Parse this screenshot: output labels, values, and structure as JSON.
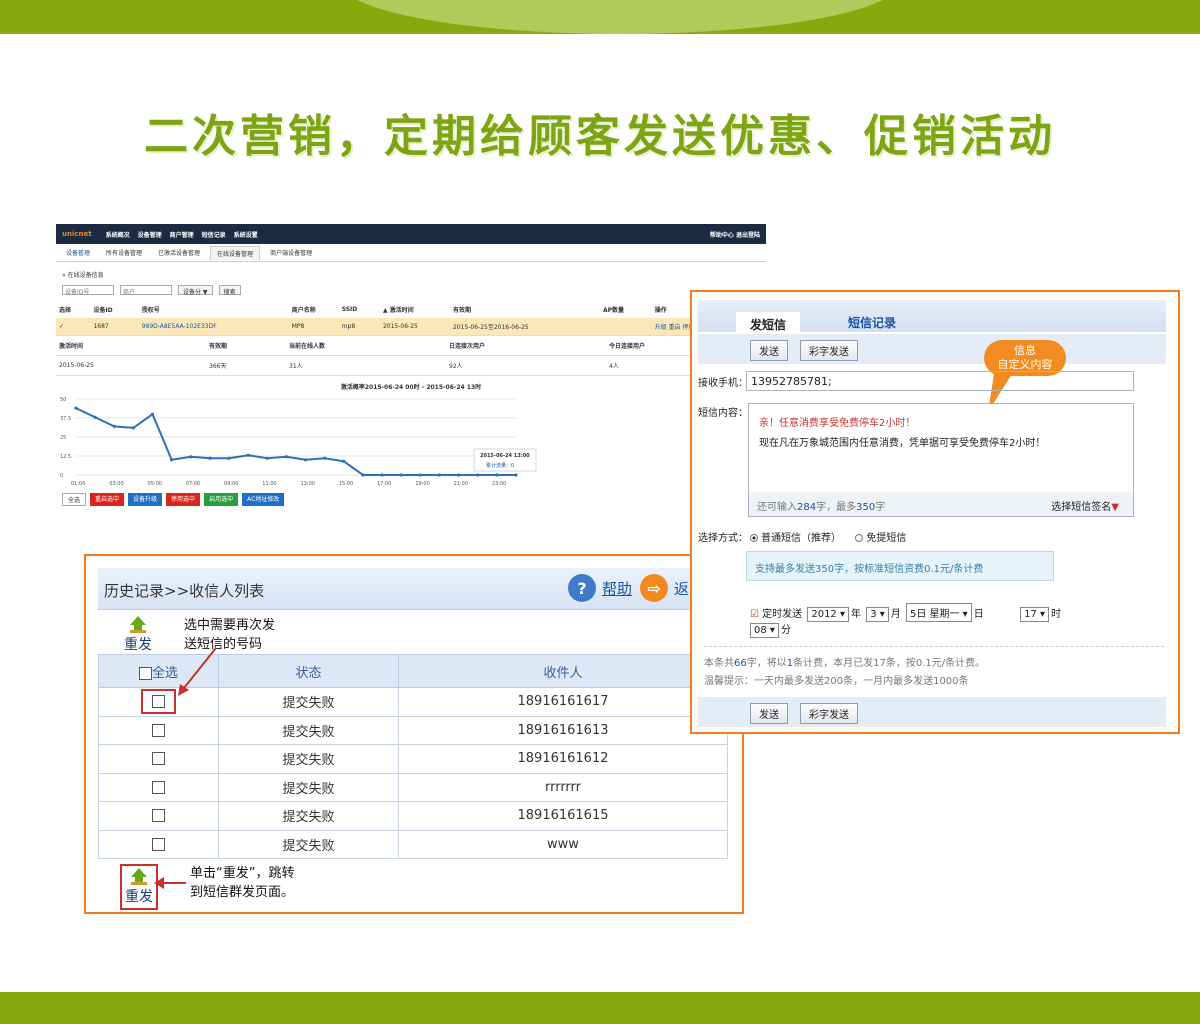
{
  "headline": "二次营销，定期给顾客发送优惠、促销活动",
  "dashboard": {
    "logo": "unicnet",
    "nav_items": [
      "系统概况",
      "设备管理",
      "商户管理",
      "短信记录",
      "系统设置"
    ],
    "nav_right": "帮助中心  退出登陆",
    "sub_tabs": [
      "设备管理",
      "所有设备管理",
      "已激活设备管理",
      "在线设备管理",
      "商户端设备管理"
    ],
    "breadcrumb": "» 在线设备信息",
    "filter_device": "设备ID号",
    "filter_shop": "商户",
    "filter_select": "设备分 ▼",
    "filter_search": "搜索",
    "columns": [
      "选择",
      "设备ID",
      "授权号",
      "商户名称",
      "SSID",
      "▲ 激活时间",
      "有效期",
      "AP数量",
      "操作"
    ],
    "row": {
      "id": "1687",
      "code": "989D-A8E5AA-102E33DF",
      "shop": "MP8",
      "ssid": "mp8",
      "activated": "2015-06-25",
      "valid": "2015-06-25至2016-06-25",
      "ops": "升级 重启 停用 远程"
    },
    "summary_headers": [
      "激活时间",
      "有效期",
      "当前在线人数",
      "日连接次用户",
      "今日连接用户"
    ],
    "summary_values": [
      "2015-06-25",
      "366天",
      "31人",
      "92人",
      "4人"
    ],
    "chart_title": "激活概率2015-06-24 00时 - 2015-06-24 13时",
    "tooltip_title": "2015-06-24 13:00",
    "tooltip_value": "累计流量：0",
    "buttons": [
      "全选",
      "重启选中",
      "设备升级",
      "停用选中",
      "启用选中",
      "AC地址修改"
    ],
    "button_colors": [
      "#ffffff",
      "#d9261c",
      "#1c70c8",
      "#d9261c",
      "#25a03a",
      "#1c70c8"
    ]
  },
  "chart_data": {
    "type": "line",
    "title": "激活概率2015-06-24 00时 - 2015-06-24 13时",
    "categories": [
      "01:00",
      "02:00",
      "03:00",
      "04:00",
      "05:00",
      "06:00",
      "07:00",
      "08:00",
      "09:00",
      "10:00",
      "11:00",
      "12:00",
      "13:00",
      "14:00",
      "15:00",
      "16:00",
      "17:00",
      "18:00",
      "19:00",
      "20:00",
      "21:00",
      "22:00",
      "23:00",
      "24:00"
    ],
    "x_tick_labels": [
      "01:00",
      "03:00",
      "05:00",
      "07:00",
      "09:00",
      "11:00",
      "13:00",
      "15:00",
      "17:00",
      "19:00",
      "21:00",
      "23:00"
    ],
    "values": [
      44,
      38,
      32,
      31,
      40,
      10,
      12,
      11,
      11,
      13,
      11,
      12,
      10,
      11,
      9,
      0,
      0,
      0,
      0,
      0,
      0,
      0,
      0,
      0
    ],
    "y_tick_labels": [
      "0",
      "12.5",
      "25",
      "37.5",
      "50"
    ],
    "ylim": [
      0,
      50
    ],
    "color": "#2f6fba"
  },
  "history": {
    "title": "历史记录>>收信人列表",
    "help": "帮助",
    "back_cut": "返",
    "reissue_label": "重发",
    "note_top": [
      "选中需要再次发",
      "送短信的号码"
    ],
    "note_bottom": [
      "单击“重发”，跳转",
      "到短信群发页面。"
    ],
    "col_select_all": "全选",
    "col_status": "状态",
    "col_recipient": "收件人",
    "rows": [
      {
        "status": "提交失败",
        "recipient": "18916161617"
      },
      {
        "status": "提交失败",
        "recipient": "18916161613"
      },
      {
        "status": "提交失败",
        "recipient": "18916161612"
      },
      {
        "status": "提交失败",
        "recipient": "rrrrrrr"
      },
      {
        "status": "提交失败",
        "recipient": "18916161615"
      },
      {
        "status": "提交失败",
        "recipient": "www"
      }
    ]
  },
  "sms": {
    "tab_send": "发短信",
    "tab_records": "短信记录",
    "btn_send": "发送",
    "btn_mms": "彩字发送",
    "bubble": [
      "信息",
      "自定义内容"
    ],
    "phone_label": "接收手机：",
    "phone_value": "13952785781;",
    "content_label": "短信内容：",
    "content_line1": "亲！任意消费享受免费停车2小时！",
    "content_line2": "现在凡在万象城范围内任意消费，凭单据可享受免费停车2小时！",
    "remain_prefix": "还可输入",
    "remain_count": "284",
    "remain_mid": "字，最多",
    "remain_max": "350",
    "remain_suffix": "字",
    "signature": "选择短信签名",
    "mode_label": "选择方式：",
    "mode_normal": "普通短信（推荐）",
    "mode_free": "免提短信",
    "tip": "支持最多发送350字，按标准短信资费0.1元/条计费",
    "schedule_label": "定时发送",
    "year": "2012",
    "year_unit": "年",
    "month": "3",
    "month_unit": "月",
    "day": "5日 星期一",
    "day_unit": "日",
    "hour": "17",
    "hour_unit": "时",
    "minute": "08",
    "minute_unit": "分",
    "info_prefix": "本条共",
    "info_chars": "66",
    "info_mid": "字，将以",
    "info_count": "1",
    "info_suffix": "条计费，本月已发17条，按0.1元/条计费。",
    "warm_tip": "温馨提示：一天内最多发送200条，一月内最多发送1000条"
  }
}
